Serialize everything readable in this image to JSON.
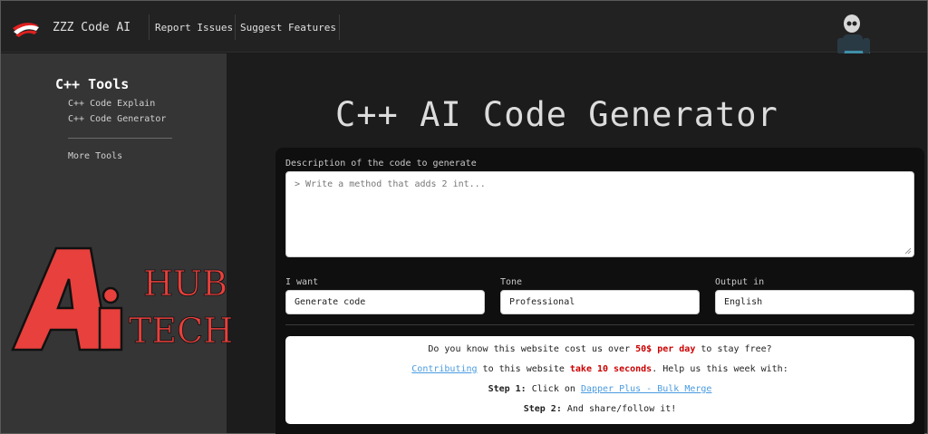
{
  "header": {
    "brand": "ZZZ Code AI",
    "nav": [
      "Report Issues",
      "Suggest Features"
    ]
  },
  "sidebar": {
    "title": "C++ Tools",
    "items": [
      "C++ Code Explain",
      "C++ Code Generator"
    ],
    "more": "More Tools"
  },
  "watermark": {
    "text": "AI HUB TECH",
    "color": "#e8403c"
  },
  "main": {
    "title": "C++ AI Code Generator",
    "description_label": "Description of the code to generate",
    "description_placeholder": "> Write a method that adds 2 int...",
    "want_label": "I want",
    "want_value": "Generate code",
    "tone_label": "Tone",
    "tone_value": "Professional",
    "output_label": "Output in",
    "output_value": "English"
  },
  "promo": {
    "l1_a": "Do you know this website cost us over ",
    "l1_b": "50$ per day",
    "l1_c": " to stay free?",
    "l2_link": "Contributing",
    "l2_b": " to this website ",
    "l2_c": "take 10 seconds",
    "l2_d": ". Help us this week with:",
    "l3_a": "Step 1:",
    "l3_b": " Click on ",
    "l3_link": "Dapper Plus - Bulk Merge",
    "l4_a": "Step 2:",
    "l4_b": " And share/follow it!"
  },
  "colors": {
    "accent_red": "#cc0000",
    "link_blue": "#4a9be0",
    "logo_red": "#e02020"
  }
}
